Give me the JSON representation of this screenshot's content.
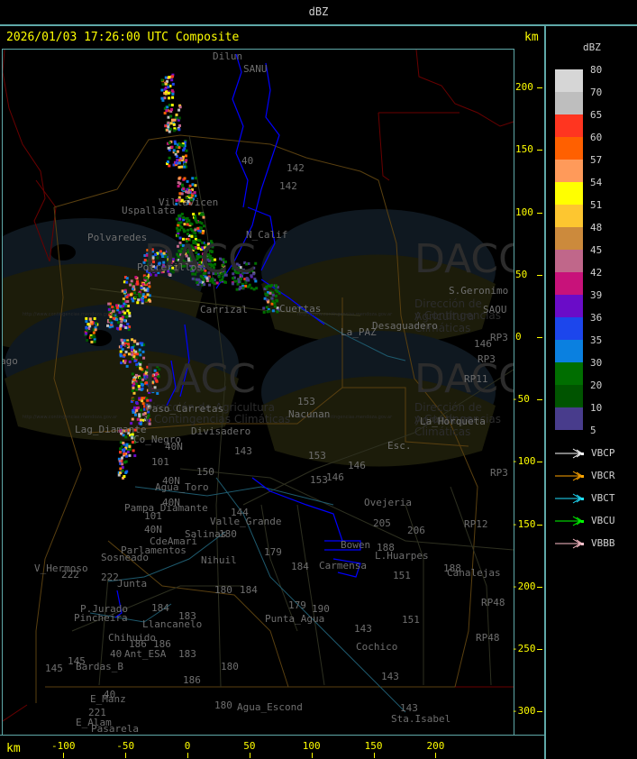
{
  "header": {
    "product": "dBZ"
  },
  "map": {
    "title": "2026/01/03 17:26:00 UTC Composite",
    "axis_unit": "km",
    "y_ticks": [
      200,
      150,
      100,
      50,
      0,
      -50,
      -100,
      -150,
      -200,
      -250,
      -300
    ],
    "x_ticks": [
      -100,
      -50,
      0,
      50,
      100,
      150,
      200
    ],
    "places": [
      "Dilun",
      "SANU",
      "40",
      "142",
      "142",
      "Villavicen",
      "Uspallata",
      "Polvaredes",
      "N_Calif",
      "Potrerillos",
      "Carrizal",
      "Cuertas",
      "La_PAZ",
      "Desaguadero",
      "S.Geronimo",
      "SAOU",
      "146",
      "RP3",
      "RP3",
      "RP11",
      "La_Horqueta",
      "153",
      "Nacunan",
      "Esc.",
      "153",
      "146",
      "146",
      "153",
      "Ovejeria",
      "205",
      "206",
      "RP3",
      "RP12",
      "ago",
      "Paso_Carretas",
      "Lag_Diamante",
      "Co_Negro",
      "Divisadero",
      "143",
      "40N",
      "101",
      "150",
      "40N",
      "Agua_Toro",
      "Pampa_Diamante",
      "40N",
      "101",
      "Valle_Grande",
      "144",
      "Salinas",
      "180",
      "40N",
      "CdeAmari",
      "Parlamentos",
      "Sosneado",
      "Nihuil",
      "V_Hermoso",
      "222",
      "222",
      "Junta",
      "180",
      "184",
      "P.Jurado",
      "Pincheira",
      "184",
      "Llancanelo",
      "183",
      "Chihuido",
      "186",
      "186",
      "40",
      "Ant_ESA",
      "183",
      "145",
      "145",
      "Bardas_B",
      "180",
      "186",
      "40",
      "E_Manz",
      "221",
      "180",
      "Agua_Escond",
      "E_Alam",
      "Pasarela",
      "179",
      "184",
      "179",
      "190",
      "Punta_Agua",
      "143",
      "Cochico",
      "143",
      "143",
      "Sta.Isabel",
      "188",
      "L.Huarpes",
      "151",
      "151",
      "188",
      "Canalejas",
      "RP48",
      "RP48",
      "Carmensa",
      "Bowen"
    ],
    "watermark": {
      "logo": "DACC",
      "line1": "Dirección de Agricultura",
      "line2": "y Contingencias Climáticas",
      "url": "http://www.contingencias.mendoza.gov.ar"
    }
  },
  "legend": {
    "title": "dBZ",
    "levels": [
      "80",
      "70",
      "65",
      "60",
      "57",
      "54",
      "51",
      "48",
      "45",
      "42",
      "39",
      "36",
      "35",
      "30",
      "20",
      "10",
      "5"
    ],
    "colors": [
      "#d6d6d6",
      "#bebebe",
      "#ff3520",
      "#ff6000",
      "#ff9a5a",
      "#ffff00",
      "#fdc630",
      "#cc8a3c",
      "#c0678a",
      "#c8127a",
      "#6a0cc8",
      "#1c46ec",
      "#0a80e0",
      "#006e00",
      "#005400",
      "#483c8c"
    ],
    "radars": [
      {
        "name": "VBCP",
        "color": "#ffffff"
      },
      {
        "name": "VBCR",
        "color": "#ffa500"
      },
      {
        "name": "VBCT",
        "color": "#20e0ff"
      },
      {
        "name": "VBCU",
        "color": "#00ff00"
      },
      {
        "name": "VBBB",
        "color": "#ffc0cb"
      }
    ]
  }
}
